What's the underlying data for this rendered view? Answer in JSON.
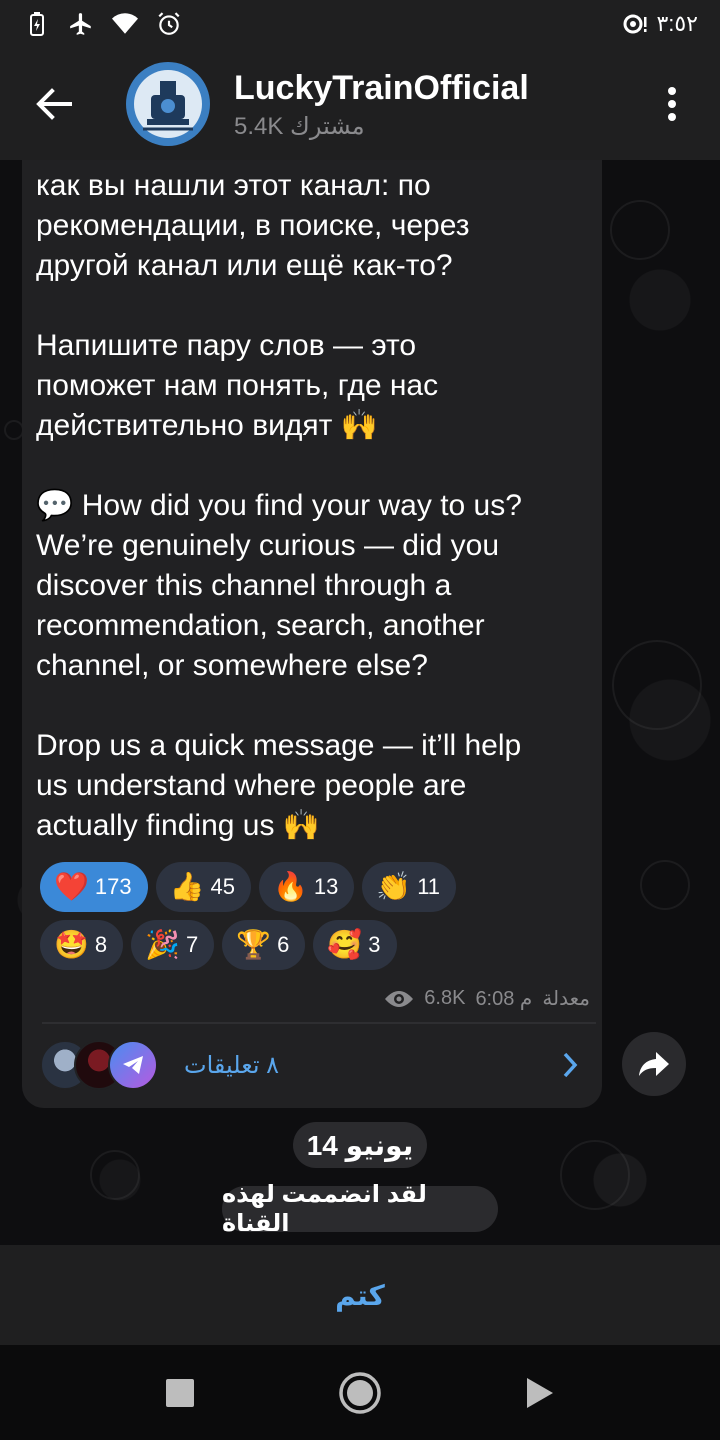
{
  "status_bar": {
    "time": "٣:٥٢",
    "icons": [
      "battery-charging-icon",
      "airplane-icon",
      "wifi-icon",
      "alarm-icon",
      "signal-icon"
    ]
  },
  "header": {
    "channel_name": "LuckyTrainOfficial",
    "subscribers": "5.4K مشترك",
    "icons": [
      "back-arrow-icon",
      "train-logo-avatar",
      "more-vert-icon"
    ]
  },
  "message": {
    "text": "как вы нашли этот канал: по\nрекомендации, в поиске, через\nдругой канал или ещё как-то?\n\nНапишите пару слов — это\nпоможет нам понять, где нас\nдействительно видят 🙌\n\n💬 How did you find your way to us?\nWe’re genuinely curious — did you\ndiscover this channel through a\nrecommendation, search, another\nchannel, or somewhere else?\n\nDrop us a quick message — it’ll help\nus understand where people are\nactually finding us 🙌",
    "reactions": [
      {
        "emoji": "❤️",
        "count": "173",
        "active": true
      },
      {
        "emoji": "👍",
        "count": "45",
        "active": false
      },
      {
        "emoji": "🔥",
        "count": "13",
        "active": false
      },
      {
        "emoji": "👏",
        "count": "11",
        "active": false
      },
      {
        "emoji": "🤩",
        "count": "8",
        "active": false
      },
      {
        "emoji": "🎉",
        "count": "7",
        "active": false
      },
      {
        "emoji": "🏆",
        "count": "6",
        "active": false
      },
      {
        "emoji": "🥰",
        "count": "3",
        "active": false
      }
    ],
    "views": "6.8K",
    "time": "6:08 م",
    "edited_label": "معدلة",
    "comments_label": "٨ تعليقات"
  },
  "date_separator": "14 يونيو",
  "service_message": "لقد انضممت لهذه القناة",
  "bottom": {
    "mute_label": "كتم"
  },
  "colors": {
    "accent": "#5aa6ec",
    "active_reaction": "#3b89d8",
    "bubble": "#212123",
    "bar": "#1f1f20"
  }
}
